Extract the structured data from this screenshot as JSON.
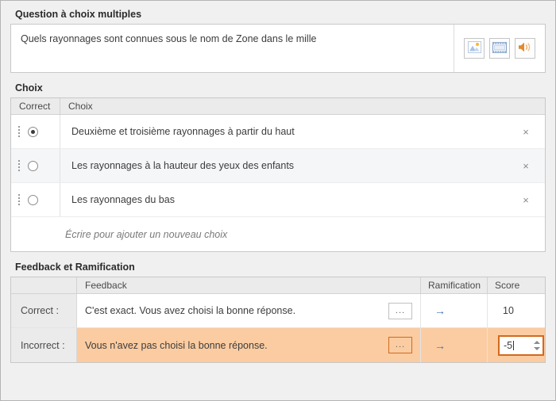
{
  "sections": {
    "question": {
      "title": "Question à choix multiples",
      "text": "Quels rayonnages sont connues sous le nom  de Zone dans le mille",
      "media_buttons": [
        {
          "name": "image-icon",
          "label": "Image"
        },
        {
          "name": "video-icon",
          "label": "Vidéo"
        },
        {
          "name": "audio-icon",
          "label": "Audio"
        }
      ]
    },
    "choices": {
      "title": "Choix",
      "columns": [
        "Correct",
        "Choix"
      ],
      "rows": [
        {
          "text": "Deuxième et troisième rayonnages à partir du haut",
          "correct": true,
          "delete_label": "×"
        },
        {
          "text": "Les rayonnages à la hauteur des yeux des enfants",
          "correct": false,
          "delete_label": "×"
        },
        {
          "text": "Les rayonnages du bas",
          "correct": false,
          "delete_label": "×"
        }
      ],
      "placeholder": "Écrire pour ajouter un nouveau choix"
    },
    "feedback": {
      "title": "Feedback et Ramification",
      "columns": [
        "",
        "Feedback",
        "Ramification",
        "Score"
      ],
      "rows": [
        {
          "label": "Correct :",
          "text": "C'est exact. Vous avez choisi la bonne réponse.",
          "ellipsis_label": "...",
          "branch_icon": "→",
          "score": "10",
          "highlighted": false
        },
        {
          "label": "Incorrect :",
          "text": "Vous n'avez pas choisi la bonne réponse.",
          "ellipsis_label": "...",
          "branch_icon": "→",
          "score": "-5",
          "highlighted": true
        }
      ]
    }
  },
  "colors": {
    "highlight": "#fbcca1",
    "focus_border": "#d2691e",
    "accent_blue": "#3f72b5",
    "panel_bg": "#f0f0f0"
  }
}
